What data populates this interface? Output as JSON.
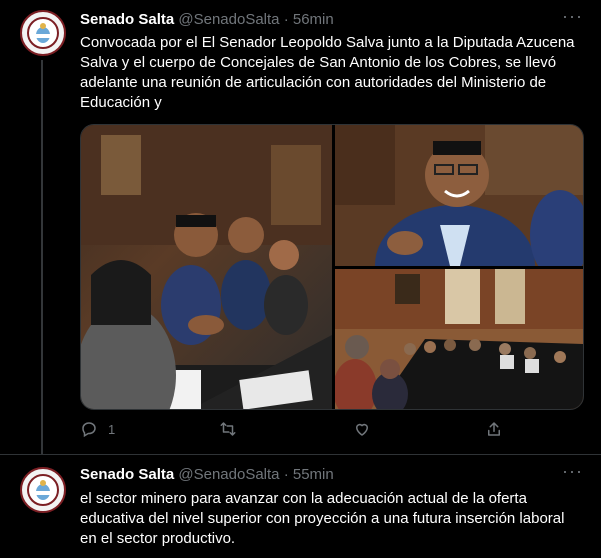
{
  "tweets": [
    {
      "author_name": "Senado Salta",
      "handle": "@SenadoSalta",
      "separator": "·",
      "time": "56min",
      "text": "Convocada por el El Senador Leopoldo Salva junto a la Diputada Azucena Salva y el cuerpo de Concejales de San Antonio de los Cobres, se llevó adelante una reunión de articulación con autoridades del Ministerio de Educación y",
      "photos": [
        "meeting-photo-1",
        "meeting-photo-2",
        "meeting-photo-3"
      ],
      "reply_count": "1",
      "icons": [
        "reply-icon",
        "retweet-icon",
        "like-icon",
        "share-icon"
      ]
    },
    {
      "author_name": "Senado Salta",
      "handle": "@SenadoSalta",
      "separator": "·",
      "time": "55min",
      "text": "el sector minero para avanzar con la adecuación actual de la oferta educativa del nivel superior con proyección a una futura inserción laboral en el sector productivo."
    }
  ],
  "more_label": "···",
  "colors": {
    "background": "#000000",
    "text": "#ffffff",
    "muted": "#71767b",
    "border": "#2f3336",
    "avatar_ring": "#7c1f24"
  }
}
